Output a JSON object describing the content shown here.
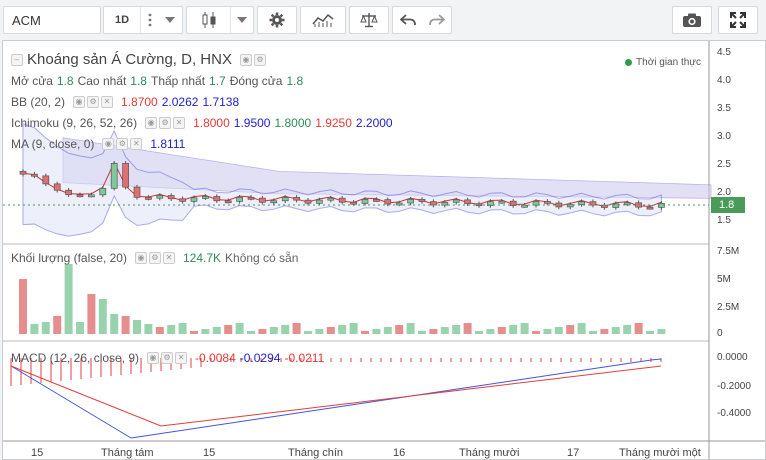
{
  "toolbar": {
    "symbol": "ACM",
    "interval": "1D"
  },
  "chart": {
    "title": "Khoáng sản Á Cường, D, HNX",
    "realtime_label": "Thời gian thực",
    "current_price": "1.8"
  },
  "ohlc": {
    "open_label": "Mở cửa",
    "open_value": "1.8",
    "high_label": "Cao nhất",
    "high_value": "1.8",
    "low_label": "Thấp nhất",
    "low_value": "1.7",
    "close_label": "Đóng cửa",
    "close_value": "1.8"
  },
  "indicators": {
    "bb": {
      "label": "BB (20, 2)",
      "v1": "1.8700",
      "v2": "2.0262",
      "v3": "1.7138"
    },
    "ichimoku": {
      "label": "Ichimoku (9, 26, 52, 26)",
      "v1": "1.8000",
      "v2": "1.9500",
      "v3": "1.8000",
      "v4": "1.9250",
      "v5": "2.2000"
    },
    "ma": {
      "label": "MA (9, close, 0)",
      "v1": "1.8111"
    },
    "volume": {
      "label": "Khối lượng (false, 20)",
      "v1": "124.7K",
      "v2": "Không có sẵn"
    },
    "macd": {
      "label": "MACD (12, 26, close, 9)",
      "v1": "-0.0084",
      "v2": "-0.0294",
      "v3": "-0.0211"
    }
  },
  "price_axis": [
    "4.5",
    "4.0",
    "3.5",
    "3.0",
    "2.5",
    "2.0",
    "1.5"
  ],
  "volume_axis": [
    "7.5M",
    "5M",
    "2.5M",
    "0"
  ],
  "macd_axis": [
    "0.0000",
    "-0.2000",
    "-0.4000"
  ],
  "time_axis": [
    "15",
    "Tháng tám",
    "15",
    "Tháng chín",
    "16",
    "Tháng mười",
    "17",
    "Tháng mười một"
  ],
  "colors": {
    "up": "#7fc89a",
    "down": "#e07070",
    "bb": "#5555dd",
    "cloud": "#ccc8ee",
    "macd": "#4455dd",
    "signal": "#e04040"
  },
  "icons": {
    "dots": "more-vertical-icon",
    "candles": "candlestick-icon",
    "gear": "gear-icon",
    "indicators": "indicators-icon",
    "compare": "scale-icon",
    "undo": "undo-icon",
    "redo": "redo-icon",
    "camera": "camera-icon",
    "fullscreen": "fullscreen-icon"
  }
}
